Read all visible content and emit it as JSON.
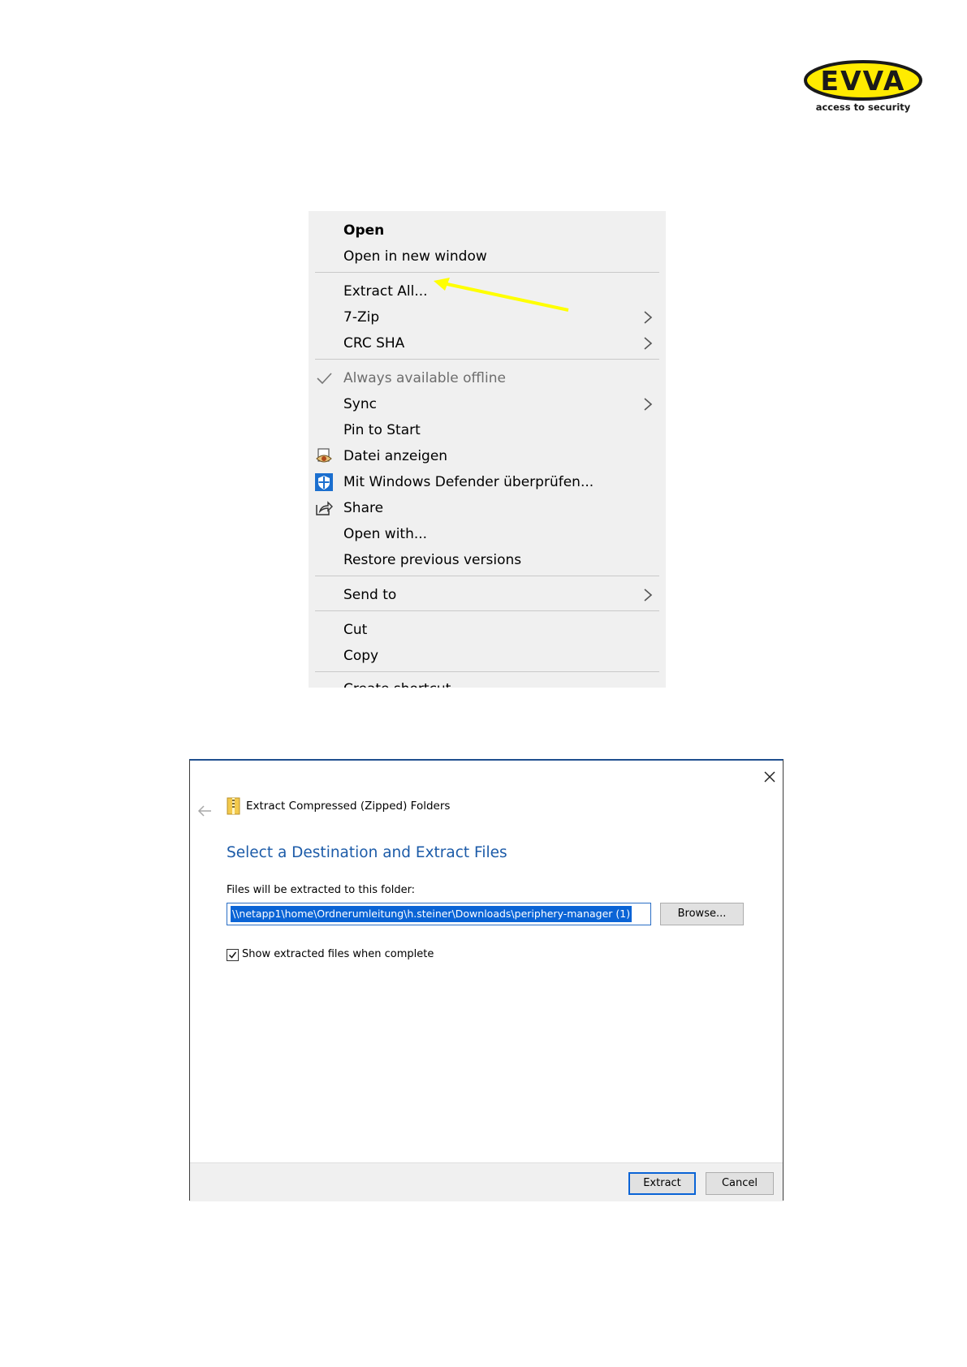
{
  "logo": {
    "brand": "EVVA",
    "tagline": "access to security"
  },
  "context_menu": {
    "items": [
      {
        "label": "Open"
      },
      {
        "label": "Open in new window"
      },
      {
        "label": "Extract All..."
      },
      {
        "label": "7-Zip"
      },
      {
        "label": "CRC SHA"
      },
      {
        "label": "Always available offline"
      },
      {
        "label": "Sync"
      },
      {
        "label": "Pin to Start"
      },
      {
        "label": "Datei anzeigen"
      },
      {
        "label": "Mit Windows Defender überprüfen..."
      },
      {
        "label": "Share"
      },
      {
        "label": "Open with..."
      },
      {
        "label": "Restore previous versions"
      },
      {
        "label": "Send to"
      },
      {
        "label": "Cut"
      },
      {
        "label": "Copy"
      },
      {
        "label": "Create shortcut"
      }
    ],
    "highlight_arrow_color": "#ffff00"
  },
  "dialog": {
    "title": "Extract Compressed (Zipped) Folders",
    "heading": "Select a Destination and Extract Files",
    "folder_label": "Files will be extracted to this folder:",
    "path_value": "\\\\netapp1\\home\\Ordnerumleitung\\h.steiner\\Downloads\\periphery-manager (1)",
    "browse_label": "Browse...",
    "show_files_label": "Show extracted files when complete",
    "show_files_checked": true,
    "extract_label": "Extract",
    "cancel_label": "Cancel",
    "accent_color": "#1c5ba8"
  }
}
